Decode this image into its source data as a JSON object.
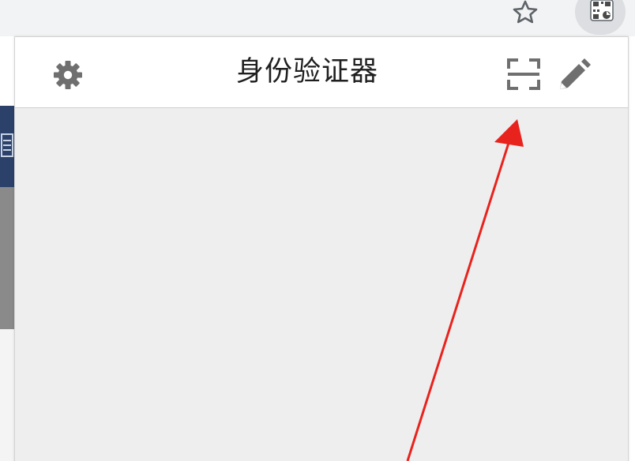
{
  "browser": {
    "icons": [
      "star-icon",
      "extension-qr-icon"
    ]
  },
  "popup": {
    "title": "身份验证器",
    "icons": {
      "settings": "gear-icon",
      "scan": "scan-qr-icon",
      "edit": "pencil-icon"
    }
  },
  "annotation": {
    "arrow_color": "#e8231d"
  },
  "colors": {
    "header_bg": "#ffffff",
    "body_bg": "#efeeef",
    "icon_gray": "#6f6f6f",
    "page_navy": "#2b4169"
  }
}
